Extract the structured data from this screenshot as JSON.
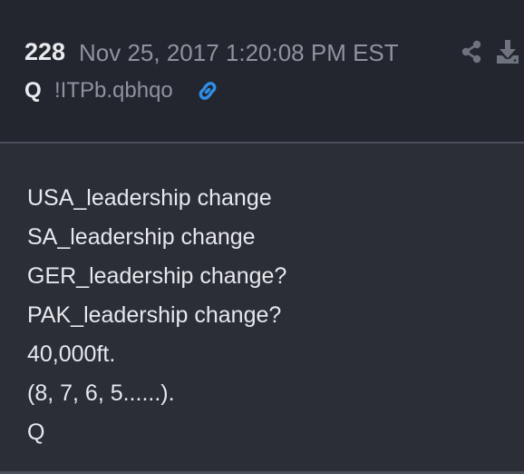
{
  "post": {
    "number": "228",
    "date": "Nov 25, 2017 1:20:08 PM EST",
    "author": "Q",
    "tripcode": "!ITPb.qbhqo",
    "lines": [
      "USA_leadership change",
      "SA_leadership change",
      "GER_leadership change?",
      "PAK_leadership change?",
      "40,000ft.",
      "(8, 7, 6, 5......).",
      "Q"
    ]
  },
  "icons": {
    "link": "link-icon",
    "share": "share-icon",
    "download": "download-icon"
  },
  "colors": {
    "background": "#2b2e37",
    "header_background": "#23262e",
    "link_accent": "#2f8fe6",
    "muted_text": "#8e939d",
    "icon_gray": "#6e737d"
  }
}
